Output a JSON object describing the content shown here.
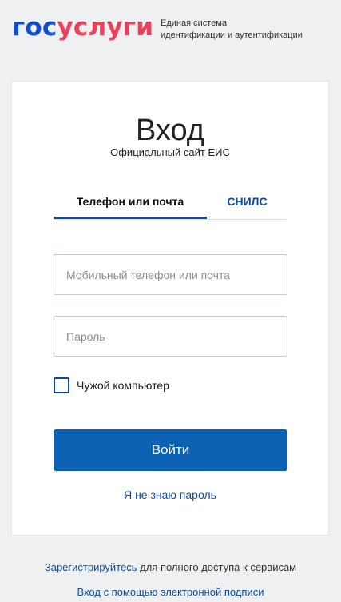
{
  "header": {
    "logo_blue": "гос",
    "logo_red": "услуги",
    "tagline_line1": "Единая система",
    "tagline_line2": "идентификации и аутентификации"
  },
  "login": {
    "title": "Вход",
    "subtitle": "Официальный сайт ЕИС",
    "tabs": [
      {
        "label": "Телефон или почта",
        "active": true
      },
      {
        "label": "СНИЛС",
        "active": false
      }
    ],
    "phone_placeholder": "Мобильный телефон или почта",
    "phone_value": "",
    "password_placeholder": "Пароль",
    "password_value": "",
    "checkbox_label": "Чужой компьютер",
    "checkbox_checked": false,
    "submit_label": "Войти",
    "forgot_label": "Я не знаю пароль"
  },
  "footer": {
    "register_link": "Зарегистрируйтесь",
    "register_text": " для полного доступа к сервисам",
    "signature_link": "Вход с помощью электронной подписи"
  },
  "colors": {
    "brand_blue": "#0d4cd3",
    "brand_red": "#ee3f58",
    "button": "#0d62b3",
    "link": "#0d4c9d",
    "background": "#eef0f2"
  }
}
